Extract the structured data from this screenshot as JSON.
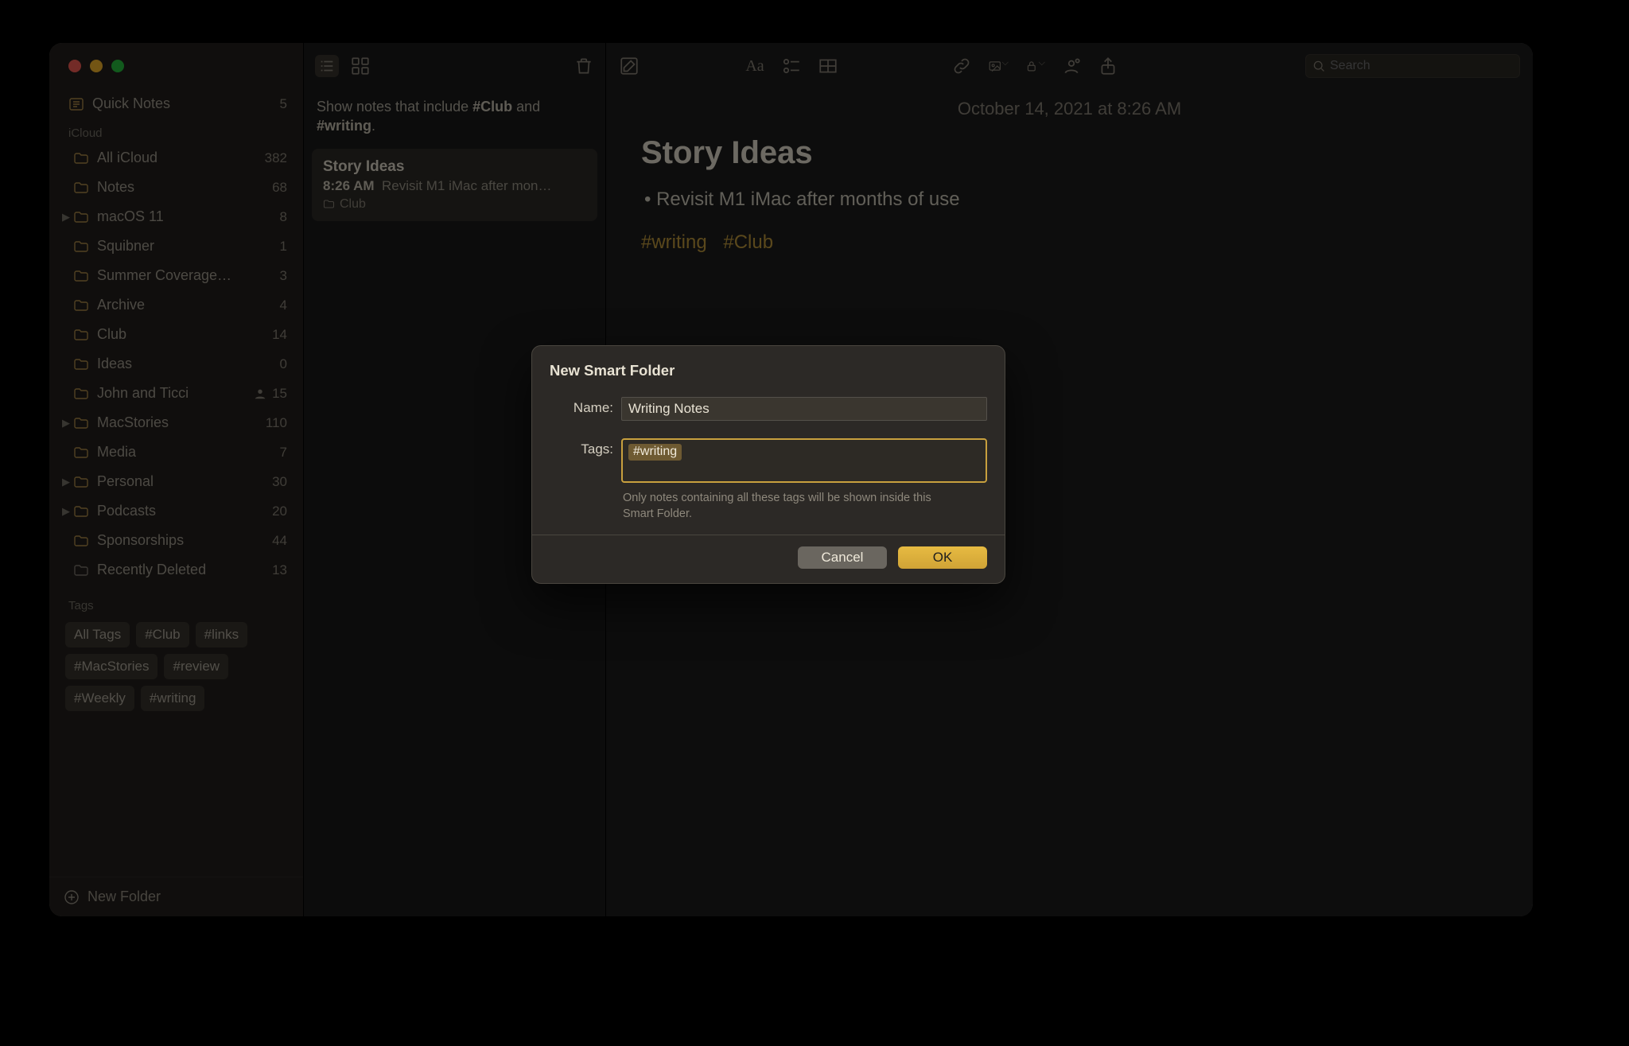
{
  "sidebar": {
    "quick": {
      "label": "Quick Notes",
      "count": "5"
    },
    "section": "iCloud",
    "items": [
      {
        "label": "All iCloud",
        "count": "382",
        "chev": false
      },
      {
        "label": "Notes",
        "count": "68",
        "chev": false
      },
      {
        "label": "macOS 11",
        "count": "8",
        "chev": true
      },
      {
        "label": "Squibner",
        "count": "1",
        "chev": false
      },
      {
        "label": "Summer Coverage…",
        "count": "3",
        "chev": false
      },
      {
        "label": "Archive",
        "count": "4",
        "chev": false
      },
      {
        "label": "Club",
        "count": "14",
        "chev": false
      },
      {
        "label": "Ideas",
        "count": "0",
        "chev": false
      },
      {
        "label": "John and Ticci",
        "count": "15",
        "chev": false,
        "shared": true
      },
      {
        "label": "MacStories",
        "count": "110",
        "chev": true
      },
      {
        "label": "Media",
        "count": "7",
        "chev": false
      },
      {
        "label": "Personal",
        "count": "30",
        "chev": true
      },
      {
        "label": "Podcasts",
        "count": "20",
        "chev": true
      },
      {
        "label": "Sponsorships",
        "count": "44",
        "chev": false
      },
      {
        "label": "Recently Deleted",
        "count": "13",
        "chev": false,
        "grey": true
      }
    ],
    "tagsHeader": "Tags",
    "tagPills": [
      "All Tags",
      "#Club",
      "#links",
      "#MacStories",
      "#review",
      "#Weekly",
      "#writing"
    ],
    "newFolder": "New Folder"
  },
  "list": {
    "prompt_pre": "Show notes that include ",
    "prompt_tag1": "#Club",
    "prompt_mid": " and ",
    "prompt_tag2": "#writing",
    "prompt_post": ".",
    "card": {
      "title": "Story Ideas",
      "time": "8:26 AM",
      "preview": "Revisit M1 iMac after mon…",
      "folder": "Club"
    }
  },
  "editor": {
    "date": "October 14, 2021 at 8:26 AM",
    "title": "Story Ideas",
    "bullet": "Revisit M1 iMac after months of use",
    "tags": [
      "#writing",
      "#Club"
    ],
    "searchPlaceholder": "Search"
  },
  "modal": {
    "heading": "New Smart Folder",
    "nameLabel": "Name:",
    "nameValue": "Writing Notes",
    "tagsLabel": "Tags:",
    "tagToken": "#writing",
    "hint": "Only notes containing all these tags will be shown inside this Smart Folder.",
    "cancel": "Cancel",
    "ok": "OK"
  }
}
